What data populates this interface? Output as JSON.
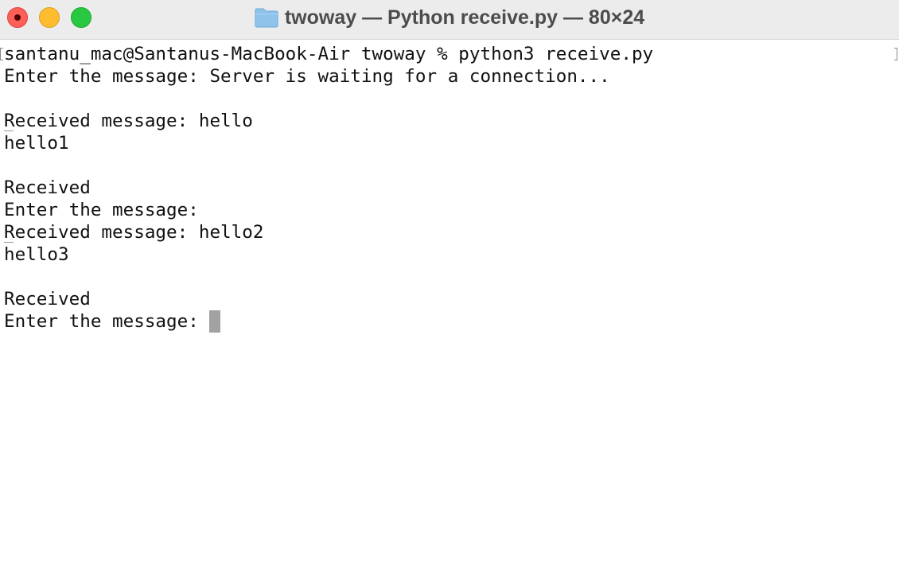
{
  "window": {
    "title": "twoway — Python receive.py — 80×24",
    "close_label": "close",
    "minimize_label": "minimize",
    "zoom_label": "zoom"
  },
  "terminal": {
    "lines": [
      "santanu_mac@Santanus-MacBook-Air twoway % python3 receive.py",
      "Enter the message: Server is waiting for a connection...",
      "",
      "Received message: hello",
      "hello1",
      "",
      "Received",
      "Enter the message:",
      "Received message: hello2",
      "hello3",
      "",
      "Received",
      "Enter the message: "
    ]
  },
  "icons": {
    "folder": "folder-icon",
    "close": "close-icon"
  },
  "colors": {
    "close": "#fe5f57",
    "minimize": "#febc2e",
    "zoom": "#28c840",
    "titlebar": "#ececec",
    "folder": "#8fc3ea",
    "cursor": "#a2a2a2"
  }
}
